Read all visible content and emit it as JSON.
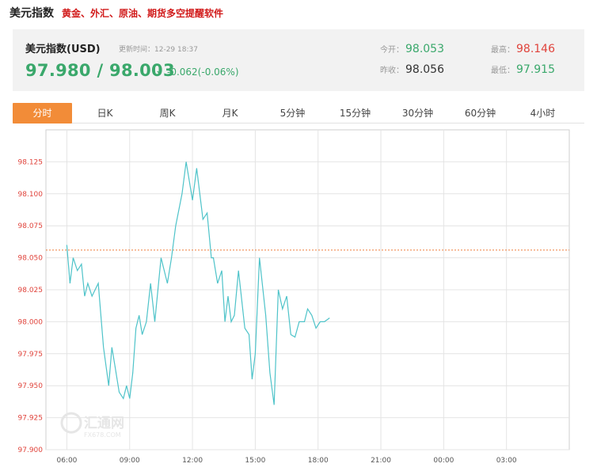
{
  "header": {
    "title": "美元指数",
    "promo": "黄金、外汇、原油、期货多空提醒软件"
  },
  "quote": {
    "name": "美元指数(USD)",
    "update_label": "更新时间：12-29 18:37",
    "price": "97.980 / 98.003",
    "direction": "down-arrow-icon",
    "change": "-0.062(-0.06%)",
    "stats": {
      "open_label": "今开：",
      "open": "98.053",
      "high_label": "最高：",
      "high": "98.146",
      "prev_close_label": "昨收：",
      "prev_close": "98.056",
      "low_label": "最低：",
      "low": "97.915"
    }
  },
  "tabs": [
    {
      "label": "分时",
      "active": true
    },
    {
      "label": "日K",
      "active": false
    },
    {
      "label": "周K",
      "active": false
    },
    {
      "label": "月K",
      "active": false
    },
    {
      "label": "5分钟",
      "active": false
    },
    {
      "label": "15分钟",
      "active": false
    },
    {
      "label": "30分钟",
      "active": false
    },
    {
      "label": "60分钟",
      "active": false
    },
    {
      "label": "4小时",
      "active": false
    }
  ],
  "colors": {
    "up": "#e0443c",
    "down": "#3aa86b",
    "line": "#4ec3c9",
    "ref_line": "#ef7d3b",
    "tab_active": "#f28c38"
  },
  "chart_data": {
    "type": "line",
    "title": "",
    "xlabel": "",
    "ylabel": "",
    "x_ticks": [
      "06:00",
      "09:00",
      "12:00",
      "15:00",
      "18:00",
      "21:00",
      "00:00",
      "03:00"
    ],
    "y_ticks": [
      "97.900",
      "97.925",
      "97.950",
      "97.975",
      "98.000",
      "98.025",
      "98.050",
      "98.075",
      "98.100",
      "98.125"
    ],
    "ylim": [
      97.9,
      98.15
    ],
    "x_unit": "hours since 06:00",
    "xlim": [
      -1,
      24
    ],
    "ref_value": 98.056,
    "series": [
      {
        "name": "",
        "x": [
          0,
          0.15,
          0.3,
          0.5,
          0.7,
          0.85,
          1.0,
          1.2,
          1.5,
          1.75,
          2.0,
          2.15,
          2.3,
          2.5,
          2.7,
          2.85,
          3.0,
          3.15,
          3.3,
          3.45,
          3.6,
          3.8,
          4.0,
          4.2,
          4.5,
          4.8,
          5.0,
          5.2,
          5.5,
          5.7,
          5.85,
          6.0,
          6.2,
          6.5,
          6.7,
          6.9,
          7.0,
          7.2,
          7.4,
          7.55,
          7.7,
          7.85,
          8.0,
          8.2,
          8.5,
          8.7,
          8.85,
          9.0,
          9.2,
          9.5,
          9.7,
          9.9,
          10.1,
          10.3,
          10.5,
          10.7,
          10.9,
          11.1,
          11.35,
          11.5,
          11.7,
          11.9,
          12.1,
          12.3,
          12.55
        ],
        "y": [
          98.06,
          98.03,
          98.05,
          98.04,
          98.045,
          98.02,
          98.03,
          98.02,
          98.03,
          97.98,
          97.95,
          97.98,
          97.965,
          97.945,
          97.94,
          97.95,
          97.94,
          97.96,
          97.995,
          98.005,
          97.99,
          98.0,
          98.03,
          98.0,
          98.05,
          98.03,
          98.05,
          98.075,
          98.1,
          98.125,
          98.11,
          98.095,
          98.12,
          98.08,
          98.085,
          98.05,
          98.05,
          98.03,
          98.04,
          98.0,
          98.02,
          98.0,
          98.005,
          98.04,
          97.995,
          97.99,
          97.955,
          97.975,
          98.05,
          98.005,
          97.96,
          97.935,
          98.025,
          98.01,
          98.02,
          97.99,
          97.988,
          98.0,
          98.0,
          98.01,
          98.005,
          97.995,
          98.0,
          98.0,
          98.003
        ]
      }
    ],
    "watermark": "汇通网 FX678.COM"
  }
}
